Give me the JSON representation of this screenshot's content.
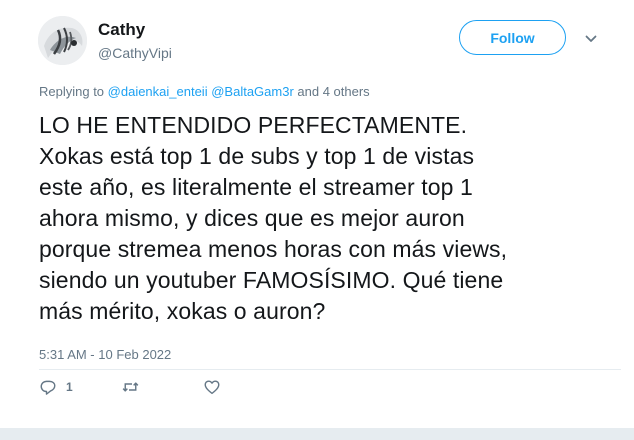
{
  "user": {
    "display_name": "Cathy",
    "handle": "@CathyVipi"
  },
  "follow_button": {
    "label": "Follow"
  },
  "replying": {
    "prefix": "Replying to ",
    "mentions": [
      "@daienkai_enteii",
      "@BaltaGam3r"
    ],
    "suffix": " and 4 others"
  },
  "tweet": {
    "lines": [
      "LO HE ENTENDIDO PERFECTAMENTE.",
      "Xokas está top 1 de subs y top 1 de vistas",
      "este año, es literalmente el streamer top 1",
      "ahora mismo, y dices que es mejor auron",
      "porque stremea menos horas con más views,",
      "siendo un youtuber FAMOSÍSIMO. Qué tiene",
      "más mérito, xokas o auron?"
    ],
    "timestamp": "5:31 AM - 10 Feb 2022"
  },
  "actions": {
    "reply_count": "1",
    "reply_icon": "reply-icon",
    "retweet_icon": "retweet-icon",
    "like_icon": "heart-icon",
    "more_icon": "chevron-down-icon"
  },
  "colors": {
    "accent": "#1da1f2",
    "secondary_text": "#657786",
    "text": "#14171a",
    "divider": "#e6ecf0"
  }
}
